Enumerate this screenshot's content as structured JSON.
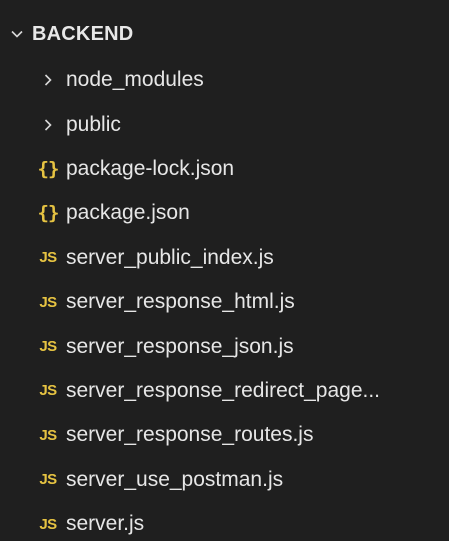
{
  "section": {
    "title": "BACKEND"
  },
  "icons": {
    "section_chevron": "chevron-down-icon",
    "folder_chevron": "chevron-right-icon",
    "json": "json-braces-icon",
    "js": "js-file-icon",
    "accent_color": "#e6c342",
    "background": "#1f1f1f"
  },
  "tree": {
    "items": [
      {
        "type": "folder",
        "label": "node_modules"
      },
      {
        "type": "folder",
        "label": "public"
      },
      {
        "type": "json",
        "label": "package-lock.json",
        "icon_text": "{}"
      },
      {
        "type": "json",
        "label": "package.json",
        "icon_text": "{}"
      },
      {
        "type": "js",
        "label": "server_public_index.js",
        "icon_text": "JS"
      },
      {
        "type": "js",
        "label": "server_response_html.js",
        "icon_text": "JS"
      },
      {
        "type": "js",
        "label": "server_response_json.js",
        "icon_text": "JS"
      },
      {
        "type": "js",
        "label": "server_response_redirect_page...",
        "icon_text": "JS"
      },
      {
        "type": "js",
        "label": "server_response_routes.js",
        "icon_text": "JS"
      },
      {
        "type": "js",
        "label": "server_use_postman.js",
        "icon_text": "JS"
      },
      {
        "type": "js",
        "label": "server.js",
        "icon_text": "JS"
      }
    ]
  }
}
